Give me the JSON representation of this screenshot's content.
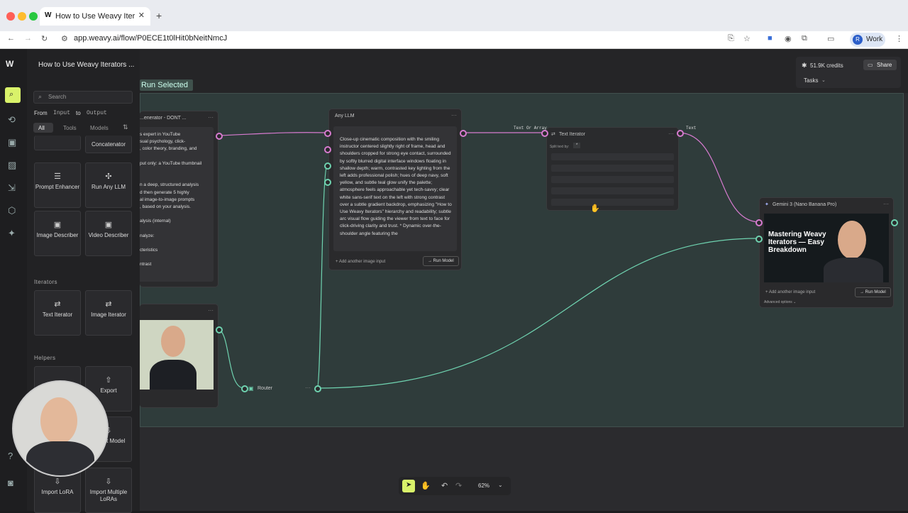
{
  "browser": {
    "tab_title": "How to Use Weavy Iterators |",
    "url": "app.weavy.ai/flow/P0ECE1t0lHit0bNeitNmcJ",
    "profile_initial": "R",
    "profile_label": "Work"
  },
  "app": {
    "flow_title": "How to Use Weavy Iterators ...",
    "credits": "51.9K credits",
    "share_label": "Share",
    "tasks_label": "Tasks",
    "run_selected_label": "Run Selected"
  },
  "panel": {
    "search_placeholder": "Search",
    "from_label": "From",
    "input_label": "Input",
    "to_label": "to",
    "output_label": "Output",
    "filters": [
      "All",
      "Tools",
      "Models"
    ],
    "tiles_top": [
      {
        "label": "Concatenator",
        "icon": "concatenator-icon"
      },
      {
        "label": "Prompt Enhancer",
        "icon": "prompt-enhancer-icon"
      },
      {
        "label": "Run Any LLM",
        "icon": "run-llm-icon"
      },
      {
        "label": "Image Describer",
        "icon": "image-describer-icon"
      },
      {
        "label": "Video Describer",
        "icon": "video-describer-icon"
      }
    ],
    "iterators_heading": "Iterators",
    "iterators": [
      {
        "label": "Text Iterator",
        "icon": "text-iterator-icon"
      },
      {
        "label": "Image Iterator",
        "icon": "image-iterator-icon"
      }
    ],
    "helpers_heading": "Helpers",
    "helpers": [
      {
        "label": "Export",
        "icon": "export-icon"
      },
      {
        "label": "Import Model",
        "icon": "import-model-icon"
      },
      {
        "label": "Import LoRA",
        "icon": "import-lora-icon"
      },
      {
        "label": "Import Multiple LoRAs",
        "icon": "import-multiple-loras-icon"
      }
    ]
  },
  "nodes": {
    "prompt_node": {
      "title": "...enerator - DONT ...",
      "lines": [
        "s expert in YouTube",
        "sual psychology, click-",
        ", color theory, branding, and",
        "",
        "put only: a YouTube thumbnail",
        "",
        "",
        "n a deep, structured analysis",
        "d then generate 5 highly",
        "al image-to-image prompts",
        ", based on your analysis.",
        "",
        "alysis (internal)",
        "",
        "nalyze:",
        "",
        "cteristics",
        "",
        "ntrast"
      ]
    },
    "any_llm": {
      "title": "Any LLM",
      "output": "Close-up cinematic composition with the smiling instructor centered slightly right of frame, head and shoulders cropped for strong eye contact, surrounded by softly blurred digital interface windows floating in shallow depth; warm, contrasted key lighting from the left adds professional polish; hues of deep navy, soft yellow, and subtle teal glow unify the palette; atmosphere feels approachable yet tech-savvy; clear white sans-serif text on the left with strong contrast over a subtle gradient backdrop, emphasizing \"How to Use Weavy Iterators\" hierarchy and readability; subtle arc visual flow guiding the viewer from text to face for click-driving clarity and trust. * Dynamic over-the-shoulder angle featuring the",
      "add_input": "+ Add another image input",
      "run_label": "→ Run Model"
    },
    "text_iterator": {
      "title": "Text Iterator",
      "input_label": "Text Or Array",
      "output_label": "Text",
      "split_label": "Split text by:",
      "split_value": "*"
    },
    "gemini": {
      "title": "Gemini 3 (Nano Banana Pro)",
      "thumb_text": "Mastering Weavy Iterators — Easy Breakdown",
      "add_input": "+ Add another image input",
      "run_label": "→ Run Model",
      "advanced": "Advanced options ⌄"
    },
    "router": {
      "title": "Router"
    }
  },
  "toolbar": {
    "zoom": "62%"
  }
}
